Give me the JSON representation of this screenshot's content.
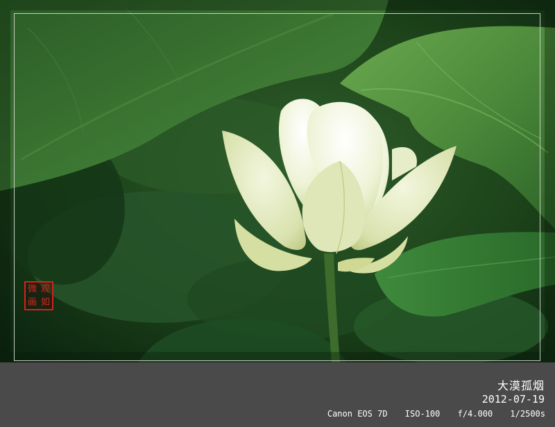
{
  "photo": {
    "subject": "white-lotus-flower",
    "colors": {
      "background_dark": "#0e2a12",
      "leaf_green": "#2f6b2e",
      "leaf_light": "#5ea04a",
      "petal": "#eef3dc",
      "stem": "#3a6a2a",
      "frame_border": "#c9cfc6"
    }
  },
  "seal": {
    "color": "#d2231d",
    "chars": [
      "观",
      "微",
      "如",
      "画"
    ]
  },
  "caption": {
    "title": "大漠孤烟",
    "date": "2012-07-19",
    "camera": "Canon EOS 7D",
    "iso": "ISO-100",
    "aperture": "f/4.000",
    "shutter": "1/2500s"
  },
  "info_bar": {
    "background": "#4a4a4a",
    "text_color": "#ffffff"
  }
}
